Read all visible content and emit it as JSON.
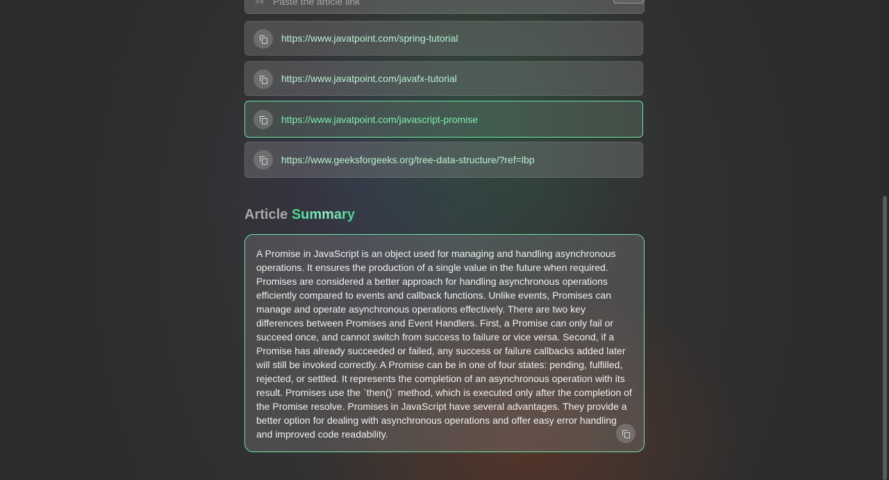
{
  "search": {
    "placeholder": "Paste the article link",
    "link_icon": "link-icon",
    "submit_icon": "enter-arrow-icon",
    "submit_glyph": "↵"
  },
  "history": {
    "copy_icon": "copy-icon",
    "items": [
      {
        "url": "https://www.javatpoint.com/spring-tutorial",
        "active": false
      },
      {
        "url": "https://www.javatpoint.com/javafx-tutorial",
        "active": false
      },
      {
        "url": "https://www.javatpoint.com/javascript-promise",
        "active": true
      },
      {
        "url": "https://www.geeksforgeeks.org/tree-data-structure/?ref=lbp",
        "active": false
      }
    ]
  },
  "summary": {
    "heading_part1": "Article",
    "heading_part2": "Summary",
    "text": "A Promise in JavaScript is an object used for managing and handling asynchronous operations. It ensures the production of a single value in the future when required. Promises are considered a better approach for handling asynchronous operations efficiently compared to events and callback functions. Unlike events, Promises can manage and operate asynchronous operations effectively. There are two key differences between Promises and Event Handlers. First, a Promise can only fail or succeed once, and cannot switch from success to failure or vice versa. Second, if a Promise has already succeeded or failed, any success or failure callbacks added later will still be invoked correctly. A Promise can be in one of four states: pending, fulfilled, rejected, or settled. It represents the completion of an asynchronous operation with its result. Promises use the `then()` method, which is executed only after the completion of the Promise resolve. Promises in JavaScript have several advantages. They provide a better option for dealing with asynchronous operations and offer easy error handling and improved code readability."
  },
  "colors": {
    "accent": "#6fe3a2",
    "background": "#2d2d2d"
  }
}
